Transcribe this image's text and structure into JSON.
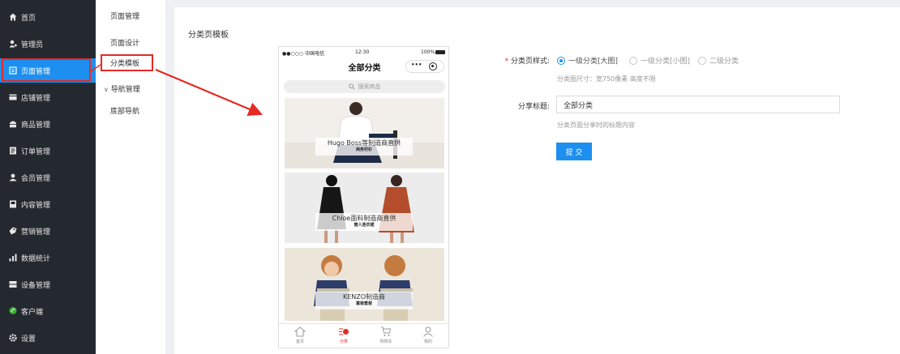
{
  "sidebar": {
    "items": [
      {
        "label": "首页",
        "icon": "home-icon"
      },
      {
        "label": "管理员",
        "icon": "admin-icon"
      },
      {
        "label": "页面管理",
        "icon": "page-icon",
        "active": true
      },
      {
        "label": "店铺管理",
        "icon": "shop-icon"
      },
      {
        "label": "商品管理",
        "icon": "goods-icon"
      },
      {
        "label": "订单管理",
        "icon": "order-icon"
      },
      {
        "label": "会员管理",
        "icon": "member-icon"
      },
      {
        "label": "内容管理",
        "icon": "content-icon"
      },
      {
        "label": "营销管理",
        "icon": "marketing-icon"
      },
      {
        "label": "数据统计",
        "icon": "stats-icon"
      },
      {
        "label": "设备管理",
        "icon": "device-icon"
      },
      {
        "label": "客户端",
        "icon": "client-icon"
      },
      {
        "label": "设置",
        "icon": "settings-icon"
      }
    ]
  },
  "subnav": {
    "items": [
      "页面管理",
      "页面设计",
      "分类模板"
    ],
    "group": {
      "label": "导航管理",
      "items": [
        "底部导航"
      ]
    }
  },
  "main": {
    "title": "分类页模板"
  },
  "phone": {
    "carrier": "●●○○○ 中国电信",
    "time": "12:30",
    "battery": "100%",
    "title": "全部分类",
    "capsule_more": "•••",
    "search_placeholder": "搜索商品",
    "banners": [
      {
        "title": "Hugo Boss等制造商直供",
        "subtitle": "商务衬衫"
      },
      {
        "title": "Chloe面料制造商直供",
        "subtitle": "丽人连衣裙"
      },
      {
        "title": "KENZO制造商",
        "subtitle": "童装套装"
      }
    ],
    "tabs": [
      {
        "label": "首页",
        "icon": "home-tab-icon"
      },
      {
        "label": "分类",
        "icon": "category-tab-icon",
        "active": true
      },
      {
        "label": "购物车",
        "icon": "cart-tab-icon"
      },
      {
        "label": "我的",
        "icon": "user-tab-icon"
      }
    ]
  },
  "form": {
    "style_label": "分类页样式:",
    "style_required_mark": "*",
    "style_options": [
      "一级分类[大图]",
      "一级分类[小图]",
      "二级分类"
    ],
    "style_selected": 0,
    "style_hint": "分类图尺寸：宽750像素 高度不限",
    "share_label": "分享标题:",
    "share_value": "全部分类",
    "share_hint": "分类页面分享时的标题内容",
    "submit_label": "提 交"
  },
  "colors": {
    "sidebar_bg": "#24292f",
    "accent": "#1c8ff0",
    "annotation": "#e32b26"
  }
}
